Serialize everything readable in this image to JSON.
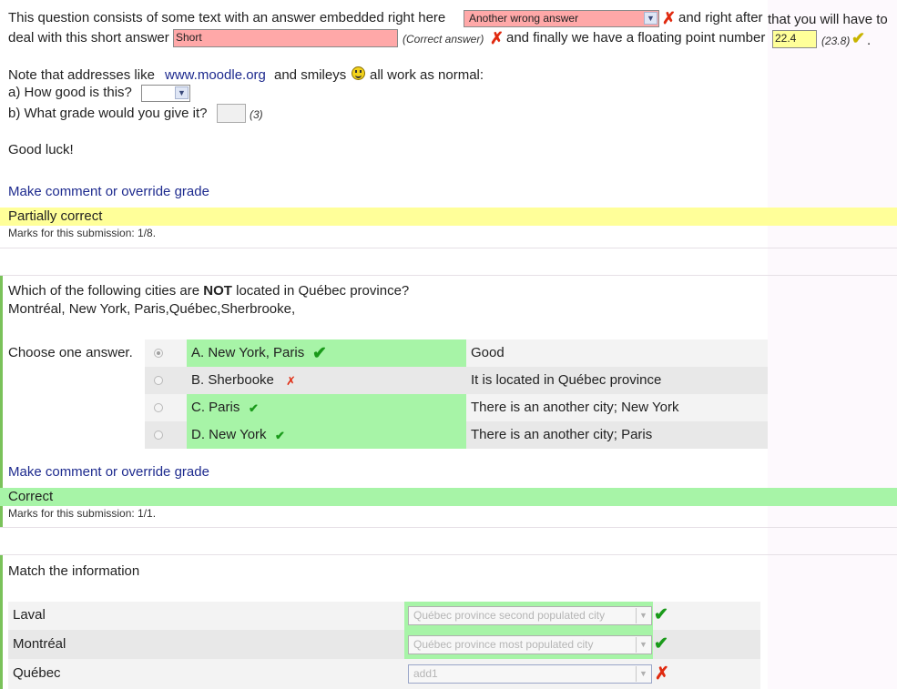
{
  "q1": {
    "text_before_select": "This question consists of some text with an answer embedded right here",
    "select_value": "Another wrong answer",
    "text_after_select": "and right after",
    "text_after_select_cont": "that you will have to",
    "text_line2_start": "deal with this short answer",
    "short_answer_value": "Short",
    "correct_answer_note": "(Correct answer)",
    "text_floating": "and finally we have a floating point number",
    "numeric_value": "22.4",
    "numeric_correct": "(23.8)",
    "period": ".",
    "note_text": "Note that addresses like",
    "note_link": "www.moodle.org",
    "note_mid": "and smileys",
    "note_end": "all work as normal:",
    "sub_a": "a) How good is this?",
    "sub_a_value": "",
    "sub_b": "b) What grade would you give it?",
    "sub_b_value": "",
    "sub_b_answer": "(3)",
    "good_luck": "Good luck!",
    "comment_link": "Make comment or override grade",
    "feedback": "Partially correct",
    "marks": "Marks for this submission: 1/8."
  },
  "q2": {
    "question_start": "Which of the following cities are",
    "question_bold": "NOT",
    "question_end": "located in Québec province?",
    "cities": "Montréal, New York, Paris,Québec,Sherbrooke,",
    "choose_label": "Choose one answer.",
    "options": [
      {
        "label": "A. New York, Paris",
        "feedback": "Good",
        "mark": "tick-large",
        "checked": true,
        "correct": true
      },
      {
        "label": "B. Sherbooke",
        "feedback": "It is located in Québec province",
        "mark": "cross-small",
        "checked": false,
        "correct": false
      },
      {
        "label": "C. Paris",
        "feedback": "There is an another city; New York",
        "mark": "tick-small",
        "checked": false,
        "correct": true
      },
      {
        "label": "D. New York",
        "feedback": "There is an another city; Paris",
        "mark": "tick-small",
        "checked": false,
        "correct": true
      }
    ],
    "comment_link": "Make comment or override grade",
    "feedback": "Correct",
    "marks": "Marks for this submission: 1/1."
  },
  "q3": {
    "title": "Match the information",
    "rows": [
      {
        "label": "Laval",
        "value": "Québec province second populated city",
        "correct": true
      },
      {
        "label": "Montréal",
        "value": "Québec province most populated city",
        "correct": true
      },
      {
        "label": "Québec",
        "value": "add1",
        "correct": false
      }
    ]
  },
  "colors": {
    "wrong_bg": "#ffa8a8",
    "partial_bg": "#ffff99",
    "correct_bg": "#a7f4a7",
    "link": "#1d2a8e"
  }
}
